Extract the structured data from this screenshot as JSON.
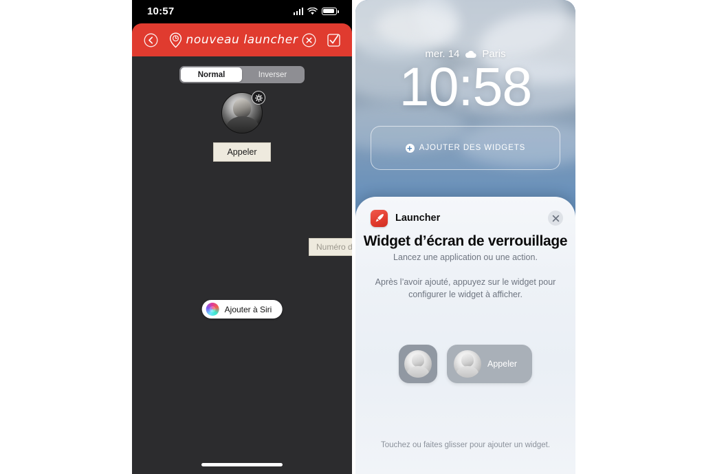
{
  "left_phone": {
    "status_bar": {
      "time": "10:57",
      "cellular_icon": "cellular-signal-icon",
      "wifi_icon": "wifi-icon",
      "battery_icon": "battery-icon"
    },
    "navbar": {
      "title": "nouveau launcher",
      "back_icon": "back-chevron-circle-icon",
      "pin_icon": "location-pin-clock-icon",
      "cancel_icon": "cancel-circle-icon",
      "confirm_icon": "checkbox-check-icon"
    },
    "segmented": {
      "options": [
        "Normal",
        "Inverser"
      ],
      "selected": "Normal"
    },
    "avatar": {
      "name": "contact-avatar",
      "settings_icon": "gear-icon"
    },
    "action_button": {
      "label": "Appeler"
    },
    "phone_field": {
      "value": "",
      "placeholder": "Numéro de téléphone",
      "contacts_icon": "address-book-icon"
    },
    "siri_button": {
      "label": "Ajouter à Siri",
      "icon": "siri-orb-icon"
    },
    "home_indicator": "home-indicator"
  },
  "right_phone": {
    "lock_screen": {
      "date": "mer. 14",
      "weather_icon": "cloud-icon",
      "location": "Paris",
      "time": "10:58",
      "widget_slot": {
        "label": "AJOUTER DES WIDGETS",
        "icon": "plus-circle-icon"
      }
    },
    "sheet": {
      "app_name": "Launcher",
      "app_icon": "launcher-app-icon",
      "close_icon": "close-icon",
      "title": "Widget d’écran de verrouillage",
      "subtitle": "Lancez une application ou une action.",
      "note": "Après l’avoir ajouté, appuyez sur le widget pour configurer le widget à afficher.",
      "previews": [
        {
          "type": "small",
          "label": "",
          "icon": "contact-photo-icon"
        },
        {
          "type": "wide",
          "label": "Appeler",
          "icon": "contact-photo-icon"
        }
      ],
      "footer": "Touchez ou faites glisser pour ajouter un widget."
    }
  },
  "colors": {
    "navbar_red": "#e03b2f",
    "app_icon_red": "#e13b2d",
    "dark_bg": "#2c2c2e",
    "field_cream": "#eeeade",
    "sky_blue": "#4f84ba"
  }
}
